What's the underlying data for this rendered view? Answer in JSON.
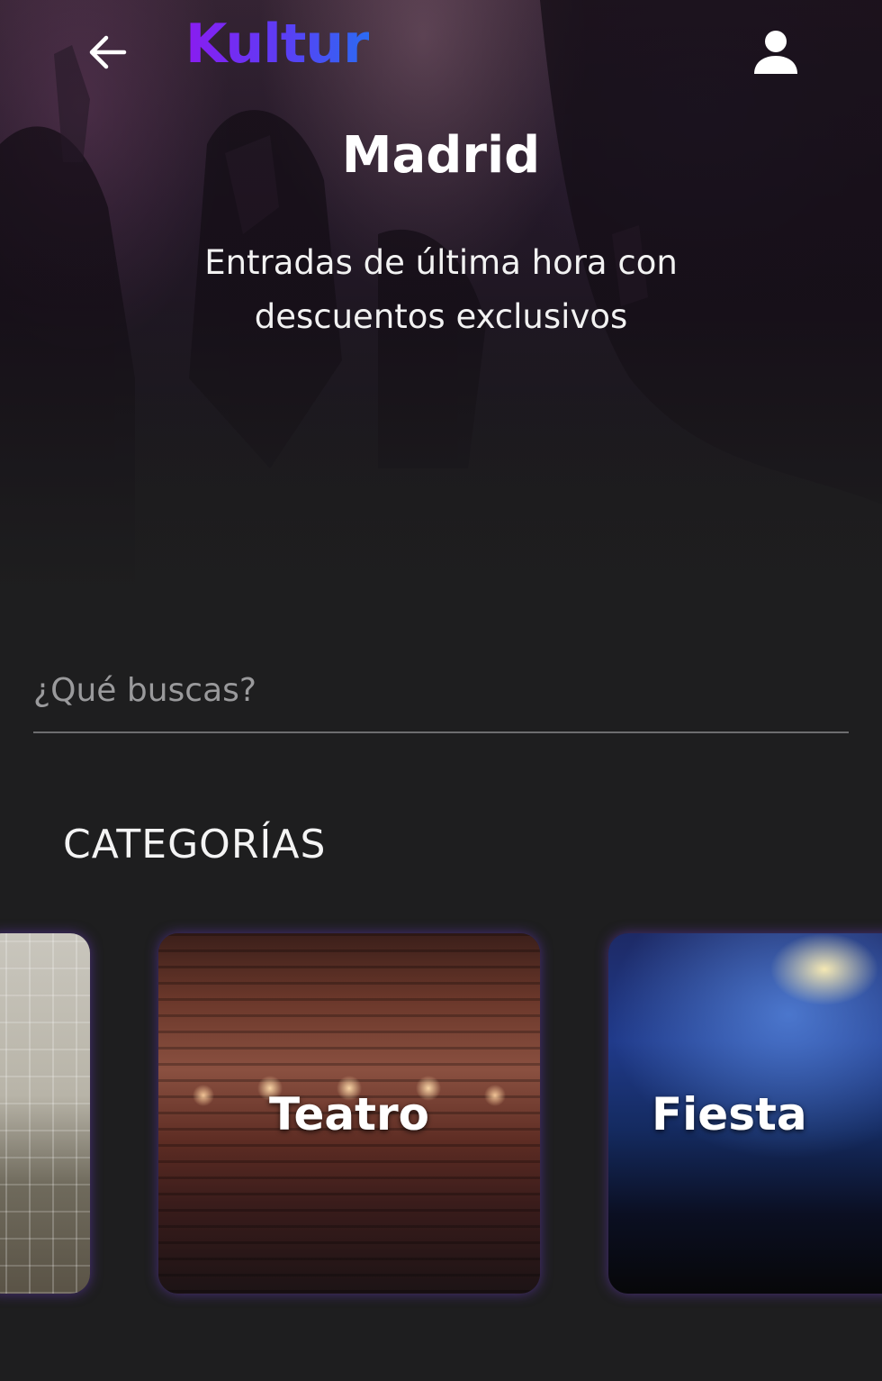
{
  "header": {
    "logo_text": "Kultur",
    "icons": {
      "back": "arrow-left-icon",
      "profile": "user-icon"
    }
  },
  "hero": {
    "title": "Madrid",
    "subtitle": "Entradas de última hora con descuentos exclusivos"
  },
  "search": {
    "placeholder": "¿Qué buscas?",
    "value": ""
  },
  "categories": {
    "heading": "CATEGORÍAS",
    "items": [
      {
        "label": ""
      },
      {
        "label": "Teatro"
      },
      {
        "label": "Fiesta"
      }
    ]
  },
  "colors": {
    "background": "#1e1e1f",
    "logo_gradient_start": "#8a1cf0",
    "logo_gradient_end": "#2b6bf2",
    "card_glow": "#6e3cc8"
  }
}
